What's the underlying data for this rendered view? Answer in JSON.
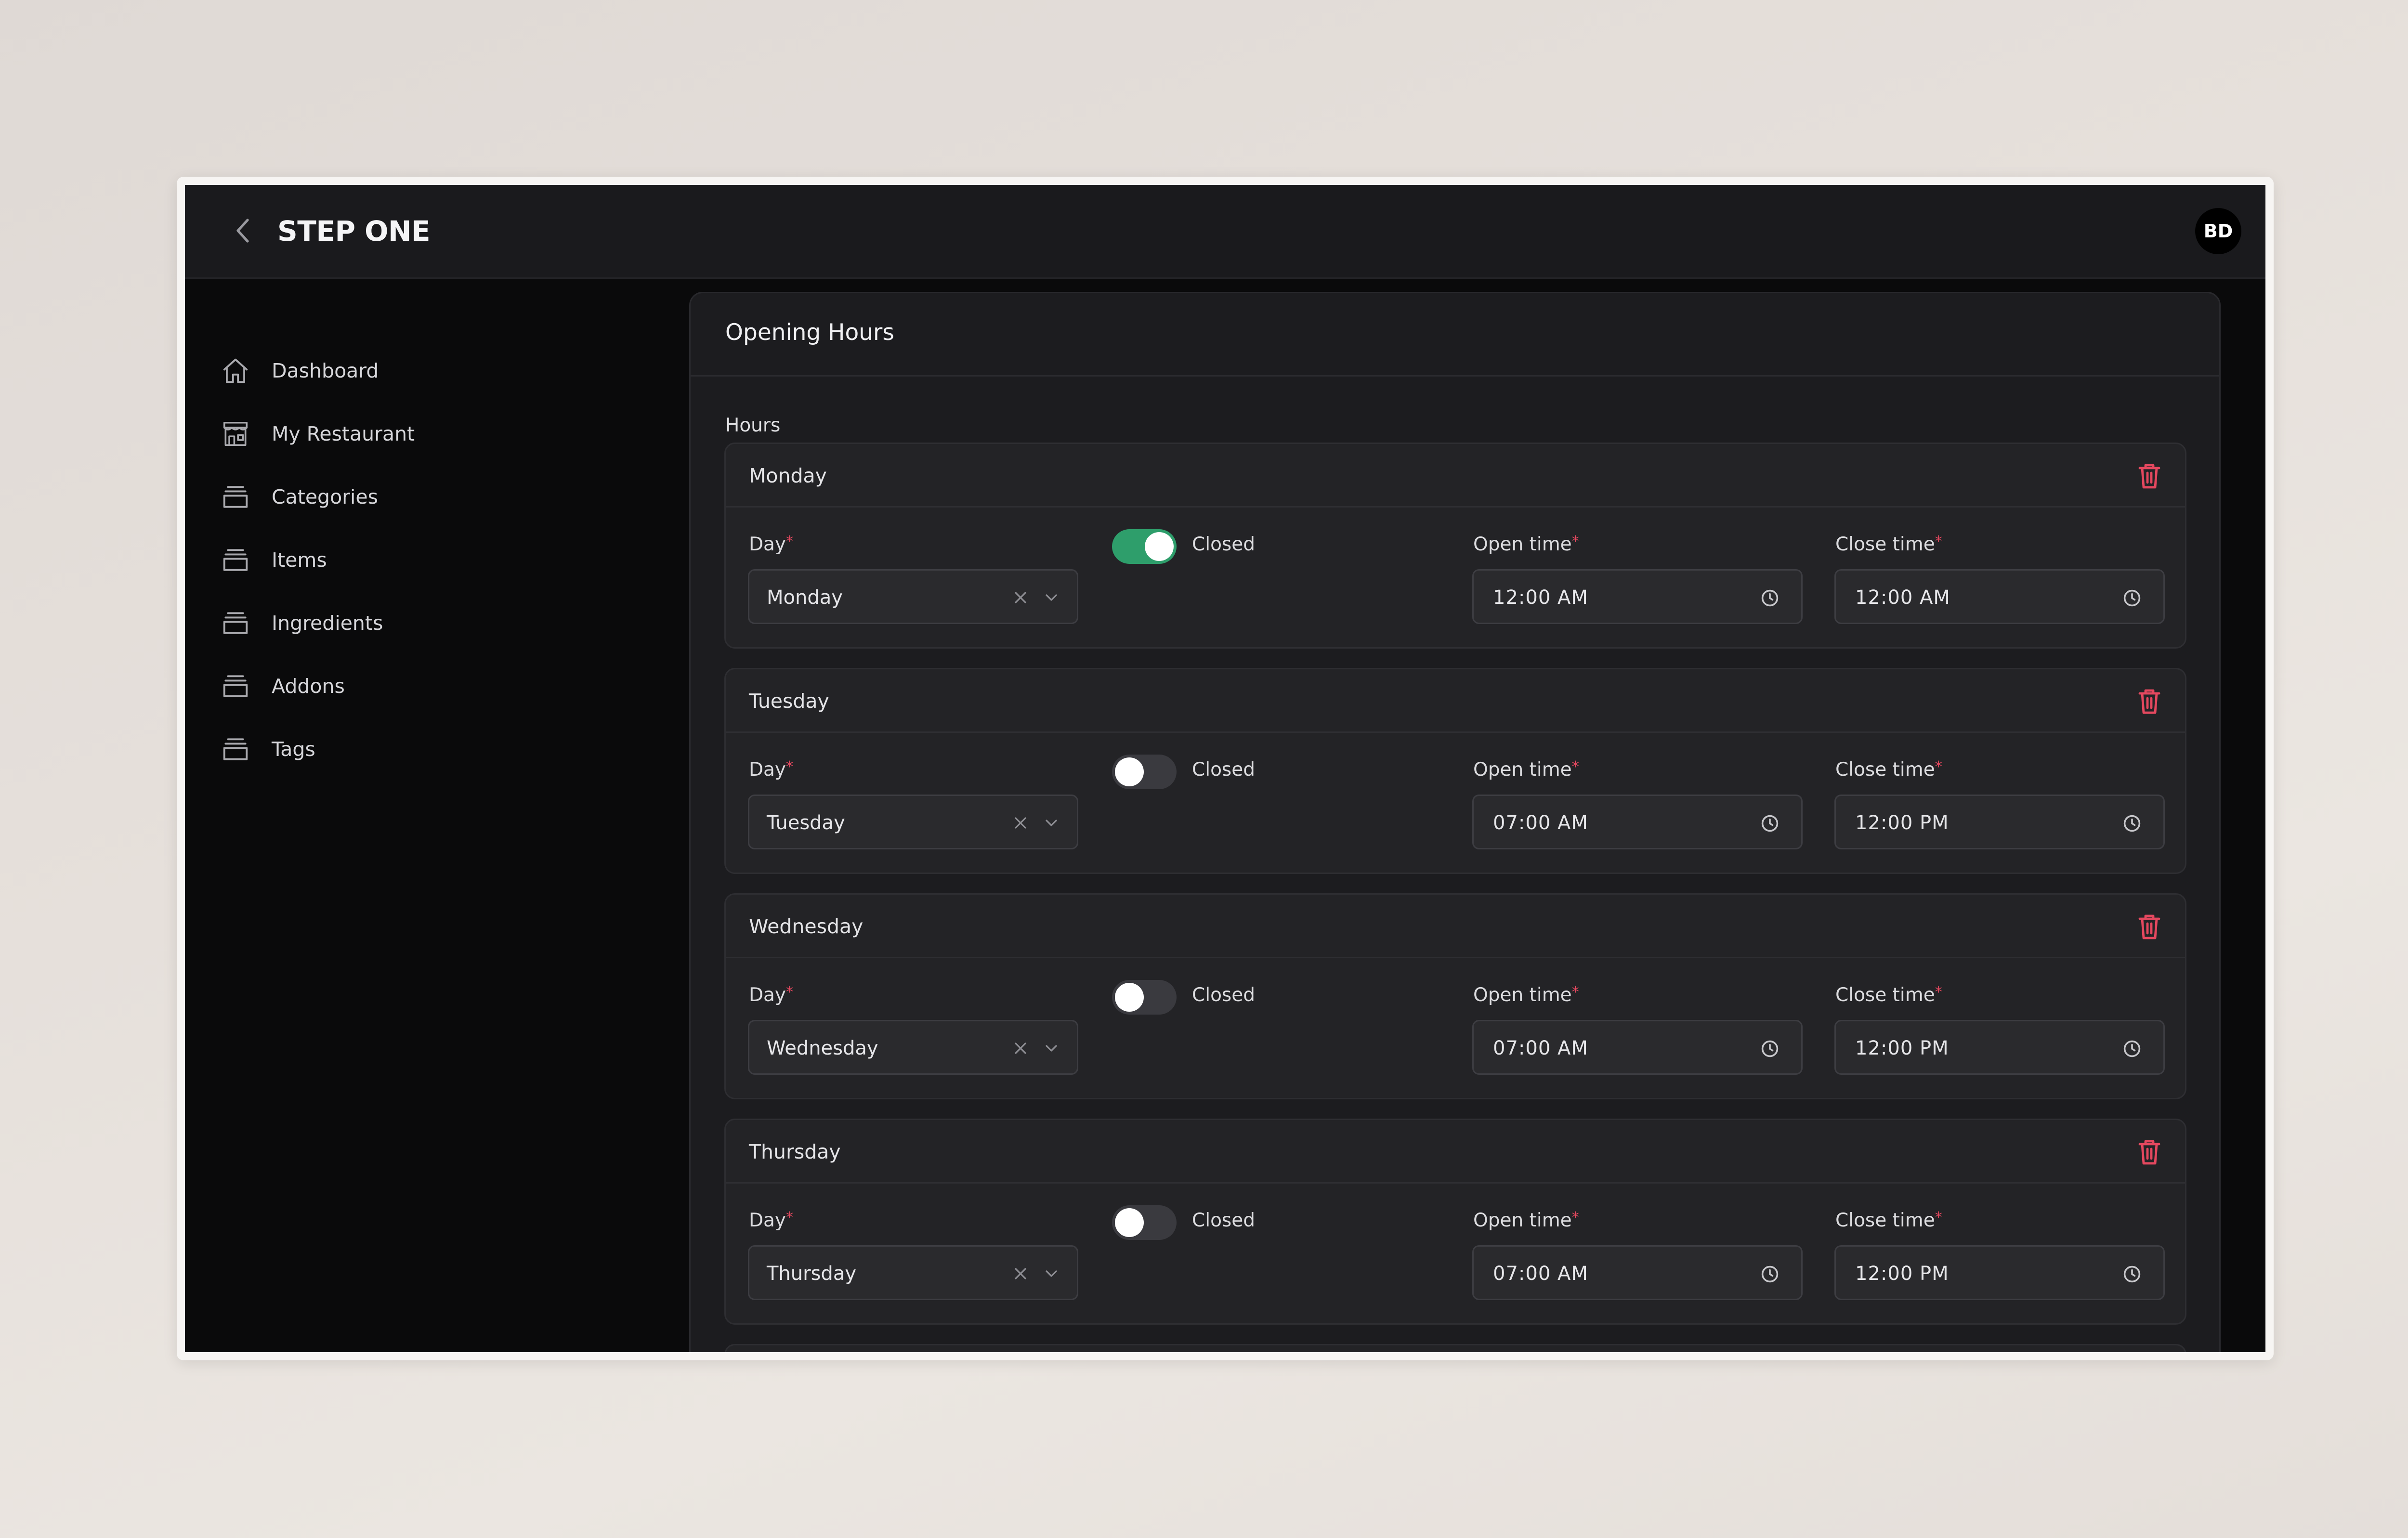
{
  "header": {
    "title": "STEP ONE",
    "avatar_initials": "BD"
  },
  "sidebar": {
    "items": [
      {
        "label": "Dashboard",
        "icon": "home-icon"
      },
      {
        "label": "My Restaurant",
        "icon": "store-icon"
      },
      {
        "label": "Categories",
        "icon": "box-icon"
      },
      {
        "label": "Items",
        "icon": "box-icon"
      },
      {
        "label": "Ingredients",
        "icon": "box-icon"
      },
      {
        "label": "Addons",
        "icon": "box-icon"
      },
      {
        "label": "Tags",
        "icon": "box-icon"
      }
    ]
  },
  "main": {
    "title": "Opening Hours",
    "hours_label": "Hours",
    "field_labels": {
      "day": "Day",
      "closed": "Closed",
      "open_time": "Open time",
      "close_time": "Close time",
      "required_mark": "*"
    },
    "days": [
      {
        "title": "Monday",
        "day_value": "Monday",
        "closed": true,
        "open_time": "12:00 AM",
        "close_time": "12:00 AM"
      },
      {
        "title": "Tuesday",
        "day_value": "Tuesday",
        "closed": false,
        "open_time": "07:00 AM",
        "close_time": "12:00 PM"
      },
      {
        "title": "Wednesday",
        "day_value": "Wednesday",
        "closed": false,
        "open_time": "07:00 AM",
        "close_time": "12:00 PM"
      },
      {
        "title": "Thursday",
        "day_value": "Thursday",
        "closed": false,
        "open_time": "07:00 AM",
        "close_time": "12:00 PM"
      }
    ]
  },
  "colors": {
    "toggle_on": "#2e9e6b",
    "delete": "#e5485f",
    "required": "#e5485f"
  }
}
